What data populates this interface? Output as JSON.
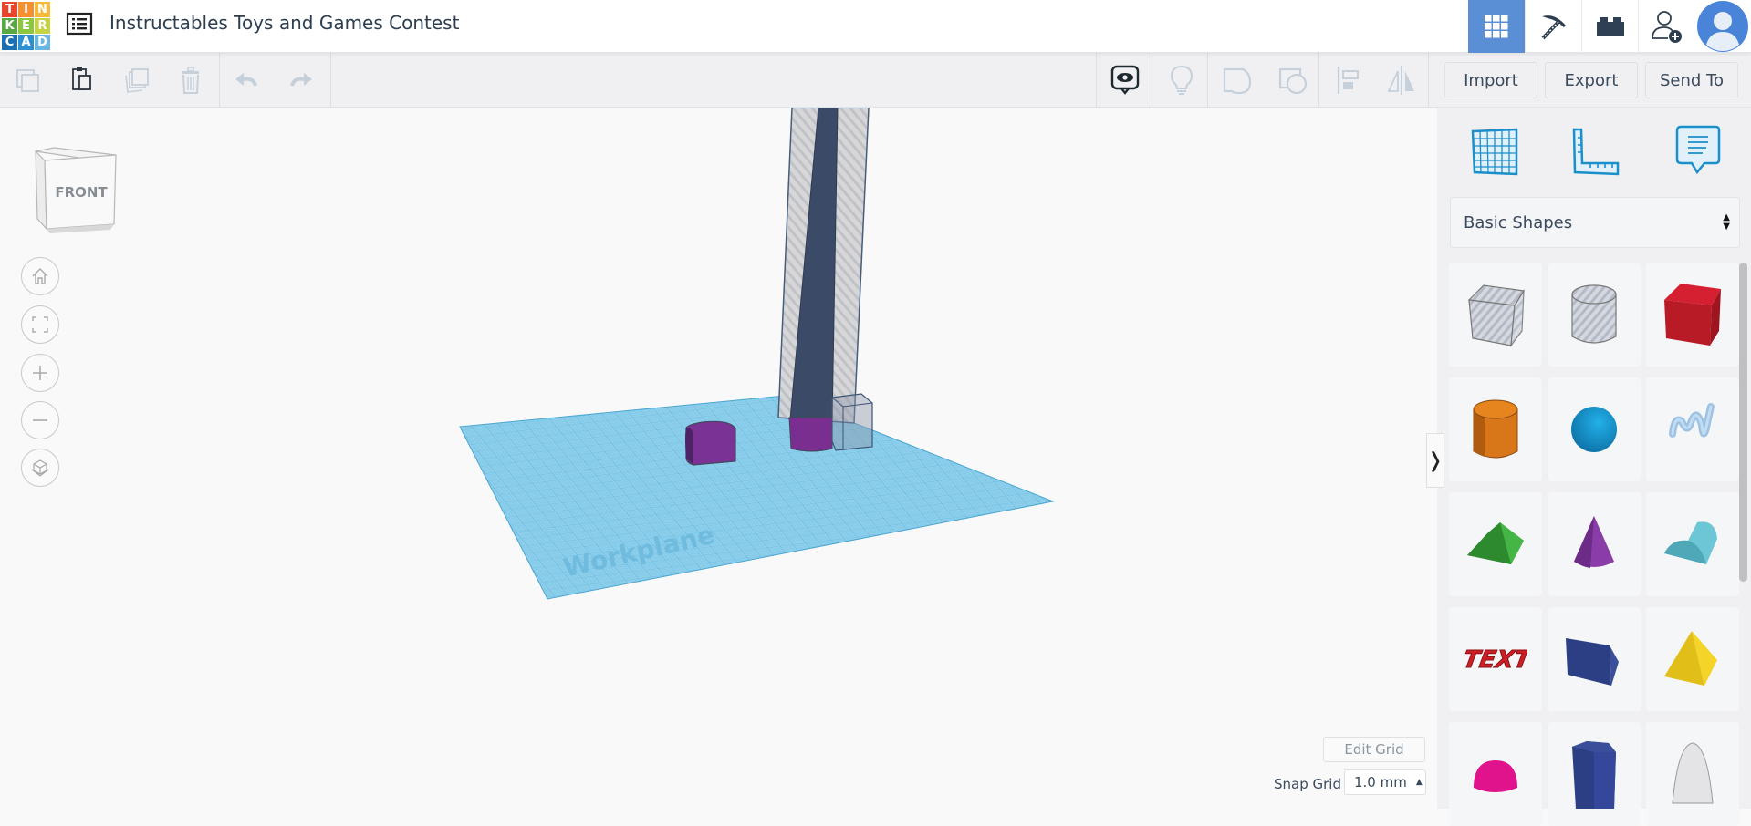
{
  "app": {
    "logo_letters": [
      "T",
      "I",
      "N",
      "K",
      "E",
      "R",
      "C",
      "A",
      "D"
    ],
    "logo_colors": [
      "#e8452c",
      "#f68e32",
      "#f6b93b",
      "#57a843",
      "#8dc63f",
      "#c6d342",
      "#1a6fb5",
      "#2e8fd1",
      "#6ab6e2"
    ],
    "project_title": "Instructables Toys and Games Contest"
  },
  "header": {
    "buttons": [
      {
        "name": "3d-design-view",
        "icon": "grid-icon",
        "active": true
      },
      {
        "name": "codeblocks",
        "icon": "pickaxe-icon",
        "active": false
      },
      {
        "name": "bricks",
        "icon": "brick-icon",
        "active": false
      },
      {
        "name": "invite-collaborator",
        "icon": "add-user-icon",
        "active": false
      }
    ],
    "accent_color": "#5a8fd6"
  },
  "toolbar": {
    "left": [
      {
        "name": "copy",
        "icon": "copy-icon",
        "enabled": false
      },
      {
        "name": "paste",
        "icon": "paste-icon",
        "enabled": true
      },
      {
        "name": "duplicate",
        "icon": "duplicate-icon",
        "enabled": false
      },
      {
        "name": "delete",
        "icon": "trash-icon",
        "enabled": false
      },
      {
        "name": "undo",
        "icon": "undo-icon",
        "enabled": false
      },
      {
        "name": "redo",
        "icon": "redo-icon",
        "enabled": false
      }
    ],
    "right": [
      {
        "name": "show-notes",
        "icon": "eye-note-icon",
        "enabled": true
      },
      {
        "name": "hint",
        "icon": "lightbulb-icon",
        "enabled": false
      },
      {
        "name": "group",
        "icon": "group-icon",
        "enabled": false
      },
      {
        "name": "ungroup",
        "icon": "ungroup-icon",
        "enabled": false
      },
      {
        "name": "align",
        "icon": "align-icon",
        "enabled": false
      },
      {
        "name": "mirror",
        "icon": "mirror-icon",
        "enabled": false
      }
    ],
    "import_label": "Import",
    "export_label": "Export",
    "send_to_label": "Send To"
  },
  "viewport": {
    "view_cube_label": "FRONT",
    "nav_buttons": [
      {
        "name": "home-view",
        "icon": "home-icon"
      },
      {
        "name": "fit-all",
        "icon": "fit-icon"
      },
      {
        "name": "zoom-in",
        "icon": "plus-icon"
      },
      {
        "name": "zoom-out",
        "icon": "minus-icon"
      },
      {
        "name": "projection",
        "icon": "perspective-icon"
      }
    ],
    "workplane_label": "Workplane",
    "edit_grid_label": "Edit Grid",
    "snap_grid_label": "Snap Grid",
    "snap_grid_value": "1.0 mm",
    "collapse_glyph": "❭"
  },
  "panel": {
    "top_icons": [
      {
        "name": "workplane-tool",
        "icon": "workplane-icon"
      },
      {
        "name": "ruler-tool",
        "icon": "ruler-icon"
      },
      {
        "name": "notes-tool",
        "icon": "note-icon"
      }
    ],
    "library_selected": "Basic Shapes",
    "shapes": [
      {
        "name": "Box Hole",
        "color": "#c8ccd4",
        "kind": "box-hole"
      },
      {
        "name": "Cylinder Hole",
        "color": "#c8ccd4",
        "kind": "cyl-hole"
      },
      {
        "name": "Box",
        "color": "#d01e2a",
        "kind": "box"
      },
      {
        "name": "Cylinder",
        "color": "#e07a1c",
        "kind": "cylinder"
      },
      {
        "name": "Sphere",
        "color": "#1a9ad6",
        "kind": "sphere"
      },
      {
        "name": "Scribble",
        "color": "#a8c8e8",
        "kind": "scribble"
      },
      {
        "name": "Roof",
        "color": "#3aaa3a",
        "kind": "roof"
      },
      {
        "name": "Cone",
        "color": "#8a3ca8",
        "kind": "cone"
      },
      {
        "name": "Round Roof",
        "color": "#68c3d4",
        "kind": "round-roof"
      },
      {
        "name": "Text",
        "color": "#cc1f25",
        "kind": "text",
        "text": "TEXT"
      },
      {
        "name": "Wedge",
        "color": "#2c3f84",
        "kind": "wedge"
      },
      {
        "name": "Pyramid",
        "color": "#eac71a",
        "kind": "pyramid"
      },
      {
        "name": "Half Sphere",
        "color": "#e0138c",
        "kind": "half-sphere"
      },
      {
        "name": "Polygon",
        "color": "#2c3f84",
        "kind": "polygon"
      },
      {
        "name": "Paraboloid",
        "color": "#dcdcdc",
        "kind": "paraboloid"
      }
    ]
  }
}
